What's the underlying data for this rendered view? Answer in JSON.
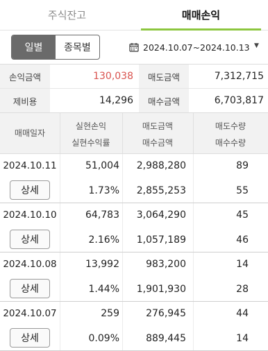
{
  "tabs": [
    {
      "label": "주식잔고",
      "active": false
    },
    {
      "label": "매매손익",
      "active": true
    }
  ],
  "segment": {
    "options": [
      "일별",
      "종목별"
    ],
    "selected": "일별"
  },
  "date_range": {
    "text": "2024.10.07~2024.10.13",
    "icon": "calendar-icon",
    "dropdown_icon": "caret-down-icon"
  },
  "summary": {
    "profit_label": "손익금액",
    "profit_value": "130,038",
    "sell_label": "매도금액",
    "sell_value": "7,312,715",
    "fee_label": "제비용",
    "fee_value": "14,296",
    "buy_label": "매수금액",
    "buy_value": "6,703,817"
  },
  "table_header": {
    "date": "매매일자",
    "realized_pl": "실현손익",
    "realized_rate": "실현수익률",
    "sell_amount": "매도금액",
    "buy_amount": "매수금액",
    "sell_qty": "매도수량",
    "buy_qty": "매수수량"
  },
  "rows": [
    {
      "date": "2024.10.11",
      "detail": "상세",
      "realized_pl": "51,004",
      "realized_rate": "1.73%",
      "sell_amount": "2,988,280",
      "buy_amount": "2,855,253",
      "sell_qty": "89",
      "buy_qty": "55"
    },
    {
      "date": "2024.10.10",
      "detail": "상세",
      "realized_pl": "64,783",
      "realized_rate": "2.16%",
      "sell_amount": "3,064,290",
      "buy_amount": "1,057,189",
      "sell_qty": "45",
      "buy_qty": "46"
    },
    {
      "date": "2024.10.08",
      "detail": "상세",
      "realized_pl": "13,992",
      "realized_rate": "1.44%",
      "sell_amount": "983,200",
      "buy_amount": "1,901,930",
      "sell_qty": "14",
      "buy_qty": "28"
    },
    {
      "date": "2024.10.07",
      "detail": "상세",
      "realized_pl": "259",
      "realized_rate": "0.09%",
      "sell_amount": "276,945",
      "buy_amount": "889,445",
      "sell_qty": "44",
      "buy_qty": "14"
    }
  ],
  "colors": {
    "accent_underline": "#8cc63f",
    "profit_red": "#d9534f",
    "segment_active": "#6a6a6a"
  }
}
